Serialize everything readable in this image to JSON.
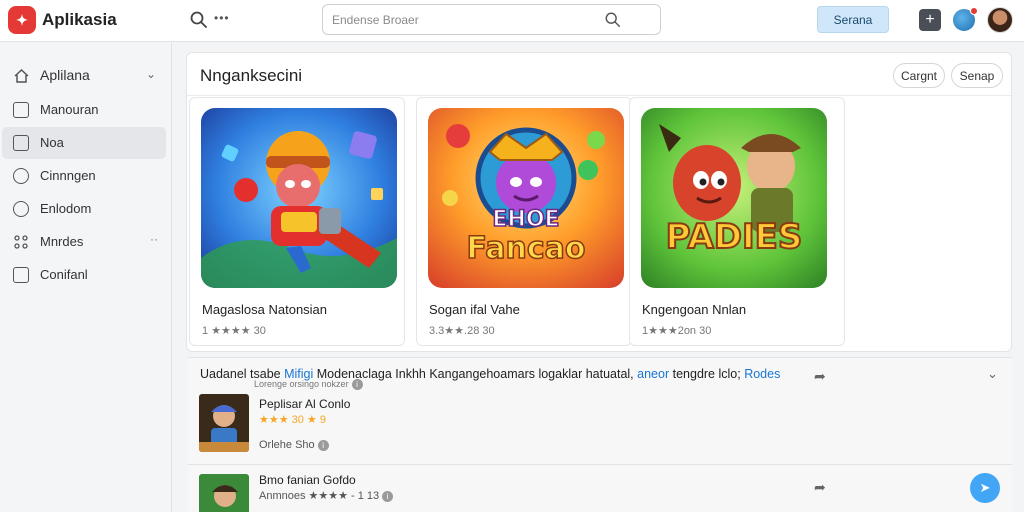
{
  "header": {
    "app_title": "Aplikasia",
    "dots": "•••",
    "search_placeholder": "Endense Broaer",
    "primary_button": "Serana",
    "icons": [
      "logo-icon",
      "search-icon",
      "add-icon",
      "globe-icon",
      "avatar"
    ]
  },
  "sidebar": {
    "items": [
      {
        "label": "Aplilana",
        "icon": "home-icon",
        "has_chevron": true
      },
      {
        "label": "Manouran",
        "icon": "document-icon"
      },
      {
        "label": "Noa",
        "icon": "folder-icon",
        "active": true
      },
      {
        "label": "Cinnngen",
        "icon": "search-icon"
      },
      {
        "label": "Enlodom",
        "icon": "clock-icon"
      },
      {
        "label": "Mnrdes",
        "icon": "apps-icon",
        "has_dots": true
      },
      {
        "label": "Conifanl",
        "icon": "chat-icon"
      }
    ]
  },
  "main": {
    "section_title": "Nnganksecini",
    "pills": [
      "Cargnt",
      "Senap"
    ],
    "cards": [
      {
        "title": "Magaslosa Natonsian",
        "meta": "1 ★★★★ 30",
        "image_text": ""
      },
      {
        "title": "Sogan ifal Vahe",
        "meta": "3.3★★.28 30",
        "image_text_1": "EHOE",
        "image_text_2": "Fancao"
      },
      {
        "title": "Kngengoan Nnlan",
        "meta": "1★★★2on 30",
        "image_text": "PADIES"
      }
    ]
  },
  "list": {
    "header_prefix": "Uadanel tsabe",
    "header_link1": "Mifigi",
    "header_mid": "Modenaclaga Inkhh Kangangehoamars logaklar hatuatal,",
    "header_link2": "aneor",
    "header_mid2": "tengdre lclo;",
    "header_link3": "Rodes",
    "header_sub": "Lorenge orsingo nokzer",
    "rows": [
      {
        "title": "Peplisar Al Conlo",
        "rating": "★★★ 30 ★ 9",
        "extra": "Orlehe Sho"
      },
      {
        "title": "Bmo fanian Gofdo",
        "rating": "Anmnoes ★★★★ - 1 13",
        "extra": ""
      }
    ]
  },
  "colors": {
    "accent": "#1976d2",
    "primary_button_bg": "#cfe7f8",
    "logo": "#e53935",
    "star": "#f5a623",
    "fab": "#42a5f5"
  }
}
